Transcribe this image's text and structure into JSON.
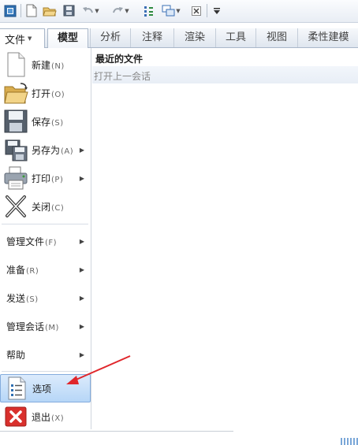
{
  "quick_access_toolbar": {
    "tools": [
      {
        "icon": "window-icon"
      },
      {
        "icon": "new-file-icon"
      },
      {
        "icon": "open-folder-icon"
      },
      {
        "icon": "save-icon"
      },
      {
        "icon": "undo-icon"
      },
      {
        "icon": "redo-icon"
      },
      {
        "icon": "regenerate-icon"
      },
      {
        "icon": "windows-icon"
      },
      {
        "icon": "close-window-icon"
      },
      {
        "icon": "customize-toolbar-icon"
      }
    ]
  },
  "ribbon": {
    "file_tab": "文件",
    "tabs": [
      {
        "label": "模型",
        "active": true
      },
      {
        "label": "分析"
      },
      {
        "label": "注释"
      },
      {
        "label": "渲染"
      },
      {
        "label": "工具"
      },
      {
        "label": "视图"
      },
      {
        "label": "柔性建模"
      }
    ]
  },
  "file_menu": {
    "items": [
      {
        "label": "新建",
        "key": "(N)",
        "icon": "new-document-icon"
      },
      {
        "label": "打开",
        "key": "(O)",
        "icon": "open-folder-icon"
      },
      {
        "label": "保存",
        "key": "(S)",
        "icon": "save-disk-icon"
      },
      {
        "label": "另存为",
        "key": "(A)",
        "icon": "save-as-icon",
        "submenu": true
      },
      {
        "label": "打印",
        "key": "(P)",
        "icon": "printer-icon",
        "submenu": true
      },
      {
        "label": "关闭",
        "key": "(C)",
        "icon": "close-x-icon"
      },
      {
        "label": "管理文件",
        "key": "(F)",
        "submenu": true
      },
      {
        "label": "准备",
        "key": "(R)",
        "submenu": true
      },
      {
        "label": "发送",
        "key": "(S)",
        "submenu": true
      },
      {
        "label": "管理会话",
        "key": "(M)",
        "submenu": true
      },
      {
        "label": "帮助",
        "submenu": true
      },
      {
        "label": "选项",
        "icon": "options-list-icon",
        "highlighted": true
      },
      {
        "label": "退出",
        "key": "(X)",
        "icon": "exit-icon"
      }
    ]
  },
  "recent_files": {
    "title": "最近的文件",
    "items": [
      "打开上一会话"
    ]
  },
  "colors": {
    "highlight": "#b6d6f7",
    "annotation_arrow": "#e0262b"
  }
}
